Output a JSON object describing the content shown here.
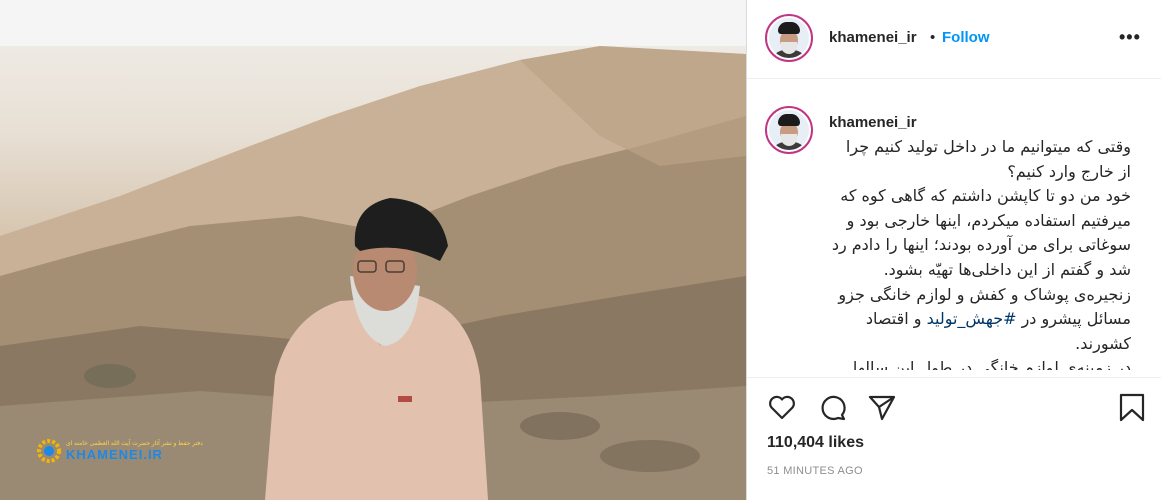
{
  "post": {
    "username": "khamenei_ir",
    "separator": "•",
    "follow_label": "Follow",
    "more_icon": "more-options-icon",
    "more_label": "•••",
    "watermark_small": "دفتر حفظ و نشر آثار حضرت آیت الله العظمی خامنه ای",
    "watermark_big": "KHAMENEI.IR"
  },
  "caption": {
    "username": "khamenei_ir",
    "para1": "وقتی که میتوانیم ما در داخل تولید کنیم چرا از خارج وارد کنیم؟",
    "para2": "خود من دو تا کاپشن داشتم که گاهی کوه که میرفتیم استفاده میکردم، اینها خارجی بود و سوغاتی برای من آورده بودند؛ اینها را دادم رد شد و گفتم از این داخلی‌ها تهیّه بشود.",
    "para3_before": "زنجیره‌ی پوشاک و کفش و لوازم خانگی جزو مسائل پیشرو در ",
    "hashtag": "#جهش_تولید",
    "para3_after": " و اقتصاد کشورند.",
    "para4": "در زمینه‌ی لوازم خانگی در طول این سالها"
  },
  "actions": {
    "like_icon": "heart-icon",
    "comment_icon": "comment-icon",
    "share_icon": "share-icon",
    "save_icon": "bookmark-icon"
  },
  "likes": "110,404 likes",
  "time_ago": "51 MINUTES AGO",
  "colors": {
    "follow": "#0095f6",
    "hashtag": "#00376b",
    "avatar_ring": "#c13584",
    "muted": "#8e8e8e"
  }
}
